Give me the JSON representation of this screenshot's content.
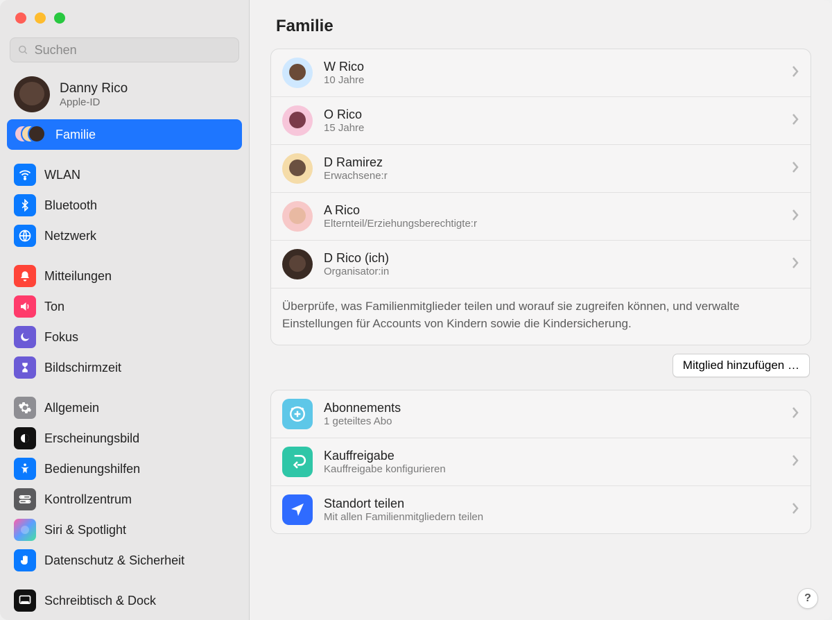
{
  "search": {
    "placeholder": "Suchen"
  },
  "account": {
    "name": "Danny Rico",
    "sub": "Apple-ID"
  },
  "sidebar": {
    "family_label": "Familie",
    "items": [
      {
        "label": "WLAN"
      },
      {
        "label": "Bluetooth"
      },
      {
        "label": "Netzwerk"
      },
      {
        "label": "Mitteilungen"
      },
      {
        "label": "Ton"
      },
      {
        "label": "Fokus"
      },
      {
        "label": "Bildschirmzeit"
      },
      {
        "label": "Allgemein"
      },
      {
        "label": "Erscheinungsbild"
      },
      {
        "label": "Bedienungshilfen"
      },
      {
        "label": "Kontrollzentrum"
      },
      {
        "label": "Siri & Spotlight"
      },
      {
        "label": "Datenschutz & Sicherheit"
      },
      {
        "label": "Schreibtisch & Dock"
      }
    ]
  },
  "page": {
    "title": "Familie",
    "members": [
      {
        "name": "W Rico",
        "sub": "10 Jahre"
      },
      {
        "name": "O Rico",
        "sub": "15 Jahre"
      },
      {
        "name": "D Ramirez",
        "sub": "Erwachsene:r"
      },
      {
        "name": "A Rico",
        "sub": "Elternteil/Erziehungsberechtigte:r"
      },
      {
        "name": "D Rico (ich)",
        "sub": "Organisator:in"
      }
    ],
    "members_footer": "Überprüfe, was Familienmitglieder teilen und worauf sie zugreifen können, und verwalte Einstellungen für Accounts von Kindern sowie die Kindersicherung.",
    "add_member_label": "Mitglied hinzufügen …",
    "features": [
      {
        "title": "Abonnements",
        "sub": "1 geteiltes Abo"
      },
      {
        "title": "Kauffreigabe",
        "sub": "Kauffreigabe konfigurieren"
      },
      {
        "title": "Standort teilen",
        "sub": "Mit allen Familienmitgliedern teilen"
      }
    ],
    "help_label": "?"
  },
  "colors": {
    "accent": "#1e76ff"
  }
}
